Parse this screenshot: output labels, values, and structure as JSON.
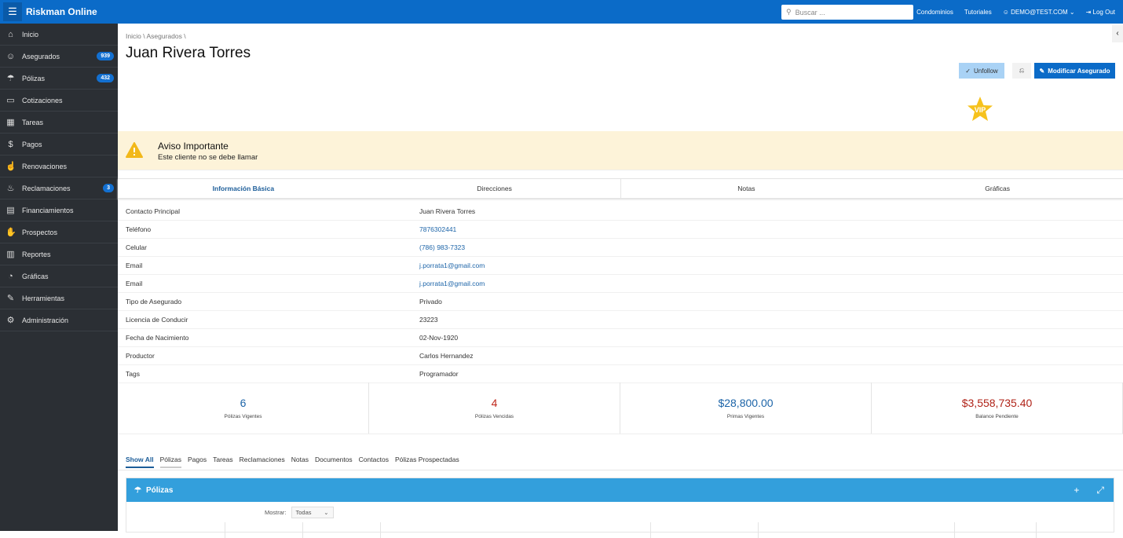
{
  "app": {
    "title": "Riskman Online"
  },
  "topbar": {
    "search_placeholder": "Buscar ...",
    "links": [
      "Condominios",
      "Tutoriales"
    ],
    "user": "DEMO@TEST.COM",
    "logout": "Log Out"
  },
  "sidebar": {
    "items": [
      {
        "label": "Inicio",
        "icon": "home-icon",
        "glyph": "⌂"
      },
      {
        "label": "Asegurados",
        "icon": "users-icon",
        "glyph": "☺",
        "badge": "939"
      },
      {
        "label": "Pólizas",
        "icon": "umbrella-icon",
        "glyph": "☂",
        "badge": "432"
      },
      {
        "label": "Cotizaciones",
        "icon": "inbox-icon",
        "glyph": "▭"
      },
      {
        "label": "Tareas",
        "icon": "calendar-clock-icon",
        "glyph": "▦"
      },
      {
        "label": "Pagos",
        "icon": "dollar-icon",
        "glyph": "$"
      },
      {
        "label": "Renovaciones",
        "icon": "thumbs-up-icon",
        "glyph": "☝"
      },
      {
        "label": "Reclamaciones",
        "icon": "fire-icon",
        "glyph": "♨",
        "badge": "3"
      },
      {
        "label": "Financiamientos",
        "icon": "wallet-icon",
        "glyph": "▤"
      },
      {
        "label": "Prospectos",
        "icon": "handshake-icon",
        "glyph": "✋"
      },
      {
        "label": "Reportes",
        "icon": "bar-chart-icon",
        "glyph": "▥"
      },
      {
        "label": "Gráficas",
        "icon": "pie-chart-icon",
        "glyph": "◔"
      },
      {
        "label": "Herramientas",
        "icon": "wrench-icon",
        "glyph": "✎"
      },
      {
        "label": "Administración",
        "icon": "gear-icon",
        "glyph": "⚙"
      }
    ]
  },
  "breadcrumb": [
    "Inicio",
    "Asegurados"
  ],
  "page": {
    "title": "Juan Rivera Torres",
    "unfollow": "Unfollow",
    "modify": "Modificar Asegurado",
    "vip": "VIP"
  },
  "alert": {
    "title": "Aviso Importante",
    "message": "Este cliente no se debe llamar"
  },
  "tabs": [
    "Información Básica",
    "Direcciones",
    "Notas",
    "Gráficas"
  ],
  "details": [
    {
      "k": "Contacto Principal",
      "v": "Juan Rivera Torres"
    },
    {
      "k": "Teléfono",
      "v": "7876302441",
      "link": true
    },
    {
      "k": "Celular",
      "v": "(786) 983-7323",
      "link": true
    },
    {
      "k": "Email",
      "v": "j.porrata1@gmail.com",
      "link": true
    },
    {
      "k": "Email",
      "v": "j.porrata1@gmail.com",
      "link": true
    },
    {
      "k": "Tipo de Asegurado",
      "v": "Privado"
    },
    {
      "k": "Licencia de Conducir",
      "v": "23223"
    },
    {
      "k": "Fecha de Nacimiento",
      "v": "02-Nov-1920"
    },
    {
      "k": "Productor",
      "v": "Carlos Hernandez"
    },
    {
      "k": "Tags",
      "v": "Programador"
    }
  ],
  "stats": [
    {
      "value": "6",
      "label": "Pólizas Vigentes",
      "color": "#1c64a8"
    },
    {
      "value": "4",
      "label": "Pólizas Vencidas",
      "color": "#c0281c"
    },
    {
      "value": "$28,800.00",
      "label": "Primas Vigentes",
      "color": "#1c64a8"
    },
    {
      "value": "$3,558,735.40",
      "label": "Balance Pendiente",
      "color": "#b02318"
    }
  ],
  "region_tabs": [
    "Show All",
    "Pólizas",
    "Pagos",
    "Tareas",
    "Reclamaciones",
    "Notas",
    "Documentos",
    "Contactos",
    "Pólizas Prospectadas"
  ],
  "polizas_panel": {
    "title": "Pólizas",
    "mostrar_label": "Mostrar:",
    "mostrar_value": "Todas"
  }
}
